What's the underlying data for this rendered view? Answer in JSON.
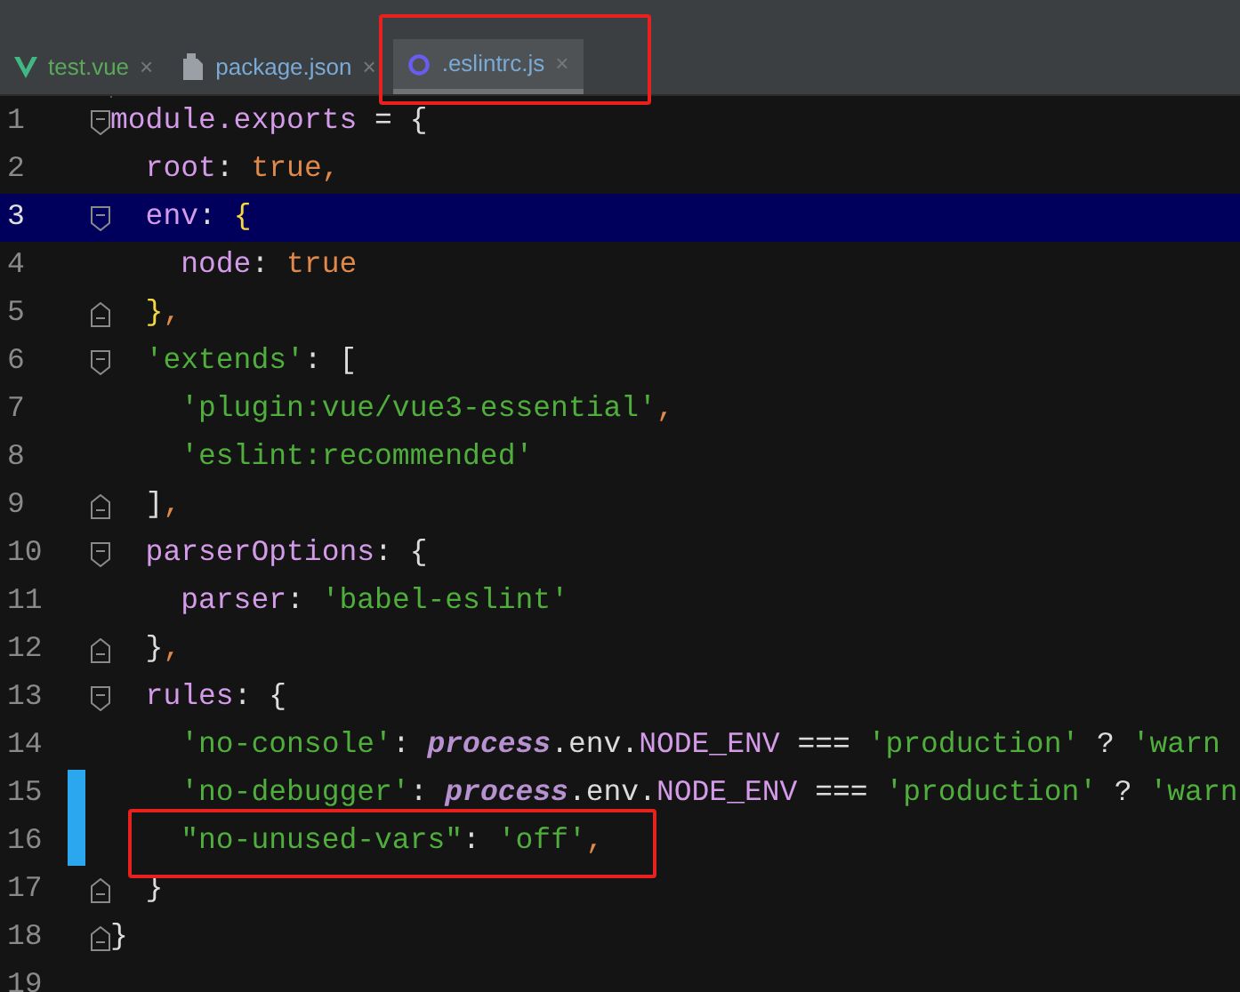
{
  "tabs": [
    {
      "label": "test.vue",
      "kind": "vue",
      "close": "×",
      "selected": false,
      "annotated": false
    },
    {
      "label": "package.json",
      "kind": "package",
      "close": "×",
      "selected": false,
      "annotated": false
    },
    {
      "label": ".eslintrc.js",
      "kind": "js",
      "close": "×",
      "selected": true,
      "annotated": true
    }
  ],
  "lines": [
    {
      "number": "1",
      "kind": "fold-start",
      "current": false,
      "changed": false,
      "annotated": false,
      "tokens": [
        {
          "kind": "key",
          "text": "module.exports"
        },
        {
          "kind": "punct",
          "text": " = {"
        }
      ]
    },
    {
      "number": "2",
      "kind": "plain",
      "current": false,
      "changed": false,
      "annotated": false,
      "tokens": [
        {
          "kind": "key",
          "text": "  root"
        },
        {
          "kind": "punct",
          "text": ": "
        },
        {
          "kind": "bool",
          "text": "true,"
        }
      ]
    },
    {
      "number": "3",
      "kind": "fold-start",
      "current": true,
      "changed": false,
      "annotated": false,
      "tokens": [
        {
          "kind": "key",
          "text": "  env"
        },
        {
          "kind": "punct",
          "text": ": "
        },
        {
          "kind": "brace",
          "text": "{"
        }
      ]
    },
    {
      "number": "4",
      "kind": "plain",
      "current": false,
      "changed": false,
      "annotated": false,
      "tokens": [
        {
          "kind": "key",
          "text": "    node"
        },
        {
          "kind": "punct",
          "text": ": "
        },
        {
          "kind": "bool",
          "text": "true"
        }
      ]
    },
    {
      "number": "5",
      "kind": "fold-end",
      "current": false,
      "changed": false,
      "annotated": false,
      "tokens": [
        {
          "kind": "brace",
          "text": "  }"
        },
        {
          "kind": "bool",
          "text": ","
        }
      ]
    },
    {
      "number": "6",
      "kind": "fold-start",
      "current": false,
      "changed": false,
      "annotated": false,
      "tokens": [
        {
          "kind": "string",
          "text": "  'extends'"
        },
        {
          "kind": "punct",
          "text": ": ["
        }
      ]
    },
    {
      "number": "7",
      "kind": "plain",
      "current": false,
      "changed": false,
      "annotated": false,
      "tokens": [
        {
          "kind": "string",
          "text": "    'plugin:vue/vue3-essential'"
        },
        {
          "kind": "bool",
          "text": ","
        }
      ]
    },
    {
      "number": "8",
      "kind": "plain",
      "current": false,
      "changed": false,
      "annotated": false,
      "tokens": [
        {
          "kind": "string",
          "text": "    'eslint:recommended'"
        }
      ]
    },
    {
      "number": "9",
      "kind": "fold-end",
      "current": false,
      "changed": false,
      "annotated": false,
      "tokens": [
        {
          "kind": "punct",
          "text": "  ]"
        },
        {
          "kind": "bool",
          "text": ","
        }
      ]
    },
    {
      "number": "10",
      "kind": "fold-start",
      "current": false,
      "changed": false,
      "annotated": false,
      "tokens": [
        {
          "kind": "key",
          "text": "  parserOptions"
        },
        {
          "kind": "punct",
          "text": ": {"
        }
      ]
    },
    {
      "number": "11",
      "kind": "plain",
      "current": false,
      "changed": false,
      "annotated": false,
      "tokens": [
        {
          "kind": "key",
          "text": "    parser"
        },
        {
          "kind": "punct",
          "text": ": "
        },
        {
          "kind": "string",
          "text": "'babel-eslint'"
        }
      ]
    },
    {
      "number": "12",
      "kind": "fold-end",
      "current": false,
      "changed": false,
      "annotated": false,
      "tokens": [
        {
          "kind": "punct",
          "text": "  }"
        },
        {
          "kind": "bool",
          "text": ","
        }
      ]
    },
    {
      "number": "13",
      "kind": "fold-start",
      "current": false,
      "changed": false,
      "annotated": false,
      "tokens": [
        {
          "kind": "key",
          "text": "  rules"
        },
        {
          "kind": "punct",
          "text": ": {"
        }
      ]
    },
    {
      "number": "14",
      "kind": "plain",
      "current": false,
      "changed": false,
      "annotated": false,
      "tokens": [
        {
          "kind": "string",
          "text": "    'no-console'"
        },
        {
          "kind": "punct",
          "text": ": "
        },
        {
          "kind": "global",
          "text": "process"
        },
        {
          "kind": "punct",
          "text": ".env."
        },
        {
          "kind": "key",
          "text": "NODE_ENV"
        },
        {
          "kind": "punct",
          "text": " === "
        },
        {
          "kind": "string",
          "text": "'production'"
        },
        {
          "kind": "punct",
          "text": " ? "
        },
        {
          "kind": "string",
          "text": "'warn"
        }
      ]
    },
    {
      "number": "15",
      "kind": "plain",
      "current": false,
      "changed": true,
      "annotated": false,
      "tokens": [
        {
          "kind": "string",
          "text": "    'no-debugger'"
        },
        {
          "kind": "punct",
          "text": ": "
        },
        {
          "kind": "global",
          "text": "process"
        },
        {
          "kind": "punct",
          "text": ".env."
        },
        {
          "kind": "key",
          "text": "NODE_ENV"
        },
        {
          "kind": "punct",
          "text": " === "
        },
        {
          "kind": "string",
          "text": "'production'"
        },
        {
          "kind": "punct",
          "text": " ? "
        },
        {
          "kind": "string",
          "text": "'warn"
        }
      ]
    },
    {
      "number": "16",
      "kind": "plain",
      "current": false,
      "changed": true,
      "annotated": true,
      "tokens": [
        {
          "kind": "string",
          "text": "    \"no-unused-vars\""
        },
        {
          "kind": "punct",
          "text": ": "
        },
        {
          "kind": "string",
          "text": "'off'"
        },
        {
          "kind": "bool",
          "text": ","
        }
      ]
    },
    {
      "number": "17",
      "kind": "fold-end",
      "current": false,
      "changed": false,
      "annotated": false,
      "tokens": [
        {
          "kind": "punct",
          "text": "  }"
        }
      ]
    },
    {
      "number": "18",
      "kind": "fold-end",
      "current": false,
      "changed": false,
      "annotated": false,
      "tokens": [
        {
          "kind": "punct",
          "text": "}"
        }
      ]
    },
    {
      "number": "19",
      "kind": "plain",
      "current": false,
      "changed": false,
      "annotated": false
    }
  ]
}
